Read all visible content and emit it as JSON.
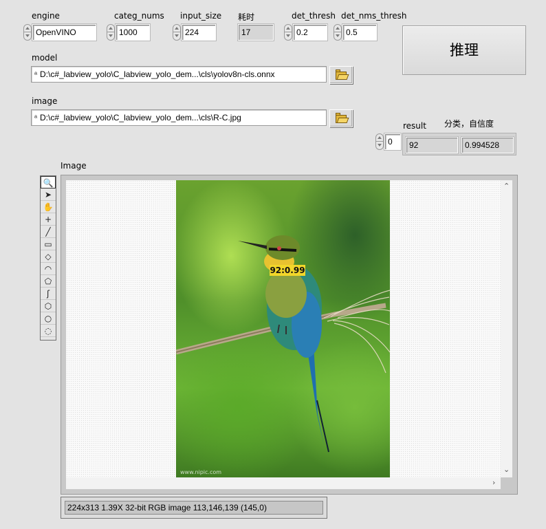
{
  "controls": {
    "engine": {
      "label": "engine",
      "value": "OpenVINO"
    },
    "categ_nums": {
      "label": "categ_nums",
      "value": "1000"
    },
    "input_size": {
      "label": "input_size",
      "value": "224"
    },
    "time": {
      "label": "耗时",
      "value": "17"
    },
    "det_thresh": {
      "label": "det_thresh",
      "value": "0.2"
    },
    "det_nms_thresh": {
      "label": "det_nms_thresh",
      "value": "0.5"
    }
  },
  "infer_button": {
    "label": "推理"
  },
  "model": {
    "label": "model",
    "path": "D:\\c#_labview_yolo\\C_labview_yolo_dem...\\cls\\yolov8n-cls.onnx"
  },
  "image_path": {
    "label": "image",
    "path": "D:\\c#_labview_yolo\\C_labview_yolo_dem...\\cls\\R-C.jpg"
  },
  "result": {
    "label": "result",
    "caption": "分类，自信度",
    "index": "0",
    "class_id": "92",
    "confidence": "0.994528"
  },
  "display": {
    "label": "Image",
    "overlay_label": "92:0.99",
    "status": "224x313 1.39X 32-bit RGB image 113,146,139     (145,0)"
  },
  "tools": [
    {
      "name": "zoom-tool-icon",
      "glyph": "🔍"
    },
    {
      "name": "pointer-tool-icon",
      "glyph": "➤"
    },
    {
      "name": "pan-tool-icon",
      "glyph": "✋"
    },
    {
      "name": "point-tool-icon",
      "glyph": "+"
    },
    {
      "name": "line-tool-icon",
      "glyph": "╱"
    },
    {
      "name": "rectangle-tool-icon",
      "glyph": "▭"
    },
    {
      "name": "rotated-rect-tool-icon",
      "glyph": "◇"
    },
    {
      "name": "annulus-tool-icon",
      "glyph": "◠"
    },
    {
      "name": "polygon-tool-icon",
      "glyph": "⬠"
    },
    {
      "name": "freehand-tool-icon",
      "glyph": "ʃ"
    },
    {
      "name": "freehand-region-tool-icon",
      "glyph": "⬡"
    },
    {
      "name": "oval-tool-icon",
      "glyph": "○"
    },
    {
      "name": "ring-tool-icon",
      "glyph": "◌"
    }
  ]
}
